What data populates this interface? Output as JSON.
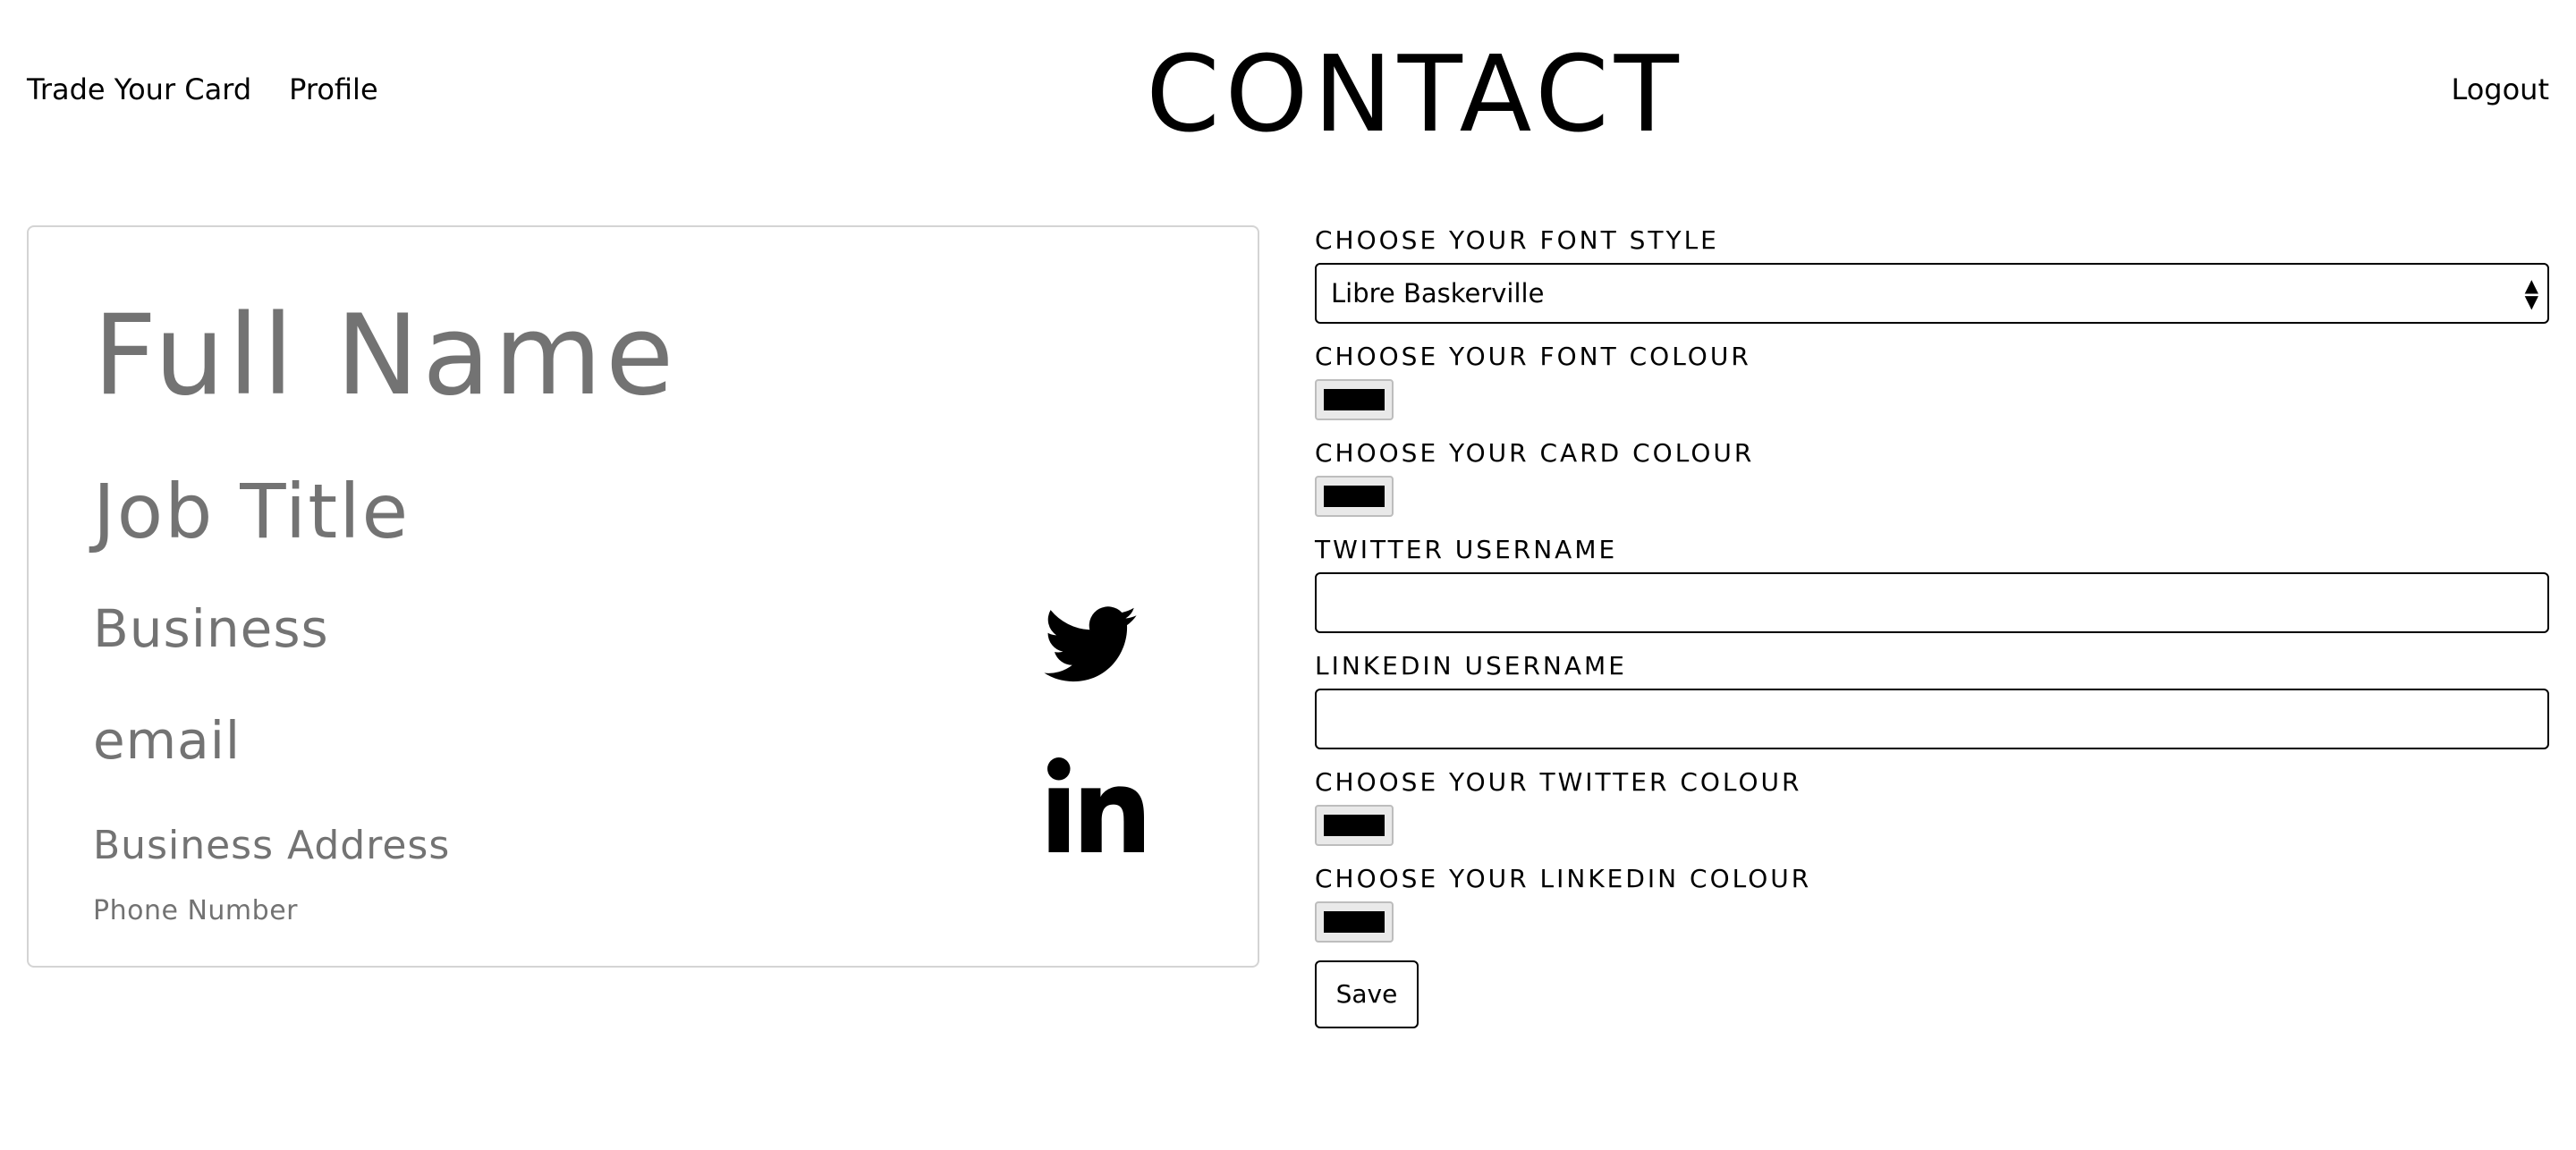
{
  "nav": {
    "trade_label": "Trade Your Card",
    "profile_label": "Profile",
    "logout_label": "Logout"
  },
  "page": {
    "title": "CONTACT"
  },
  "card": {
    "full_name": "Full Name",
    "job_title": "Job Title",
    "business": "Business",
    "email": "email",
    "address": "Business Address",
    "phone": "Phone Number",
    "text_color": "#737373",
    "icons": [
      "twitter-icon",
      "linkedin-icon"
    ]
  },
  "form": {
    "font_style_label": "CHOOSE YOUR FONT STYLE",
    "font_style_value": "Libre Baskerville",
    "font_colour_label": "CHOOSE YOUR FONT COLOUR",
    "font_colour_value": "#000000",
    "card_colour_label": "CHOOSE YOUR CARD COLOUR",
    "card_colour_value": "#000000",
    "twitter_label": "TWITTER USERNAME",
    "twitter_value": "",
    "linkedin_label": "LINKEDIN USERNAME",
    "linkedin_value": "",
    "twitter_colour_label": "CHOOSE YOUR TWITTER COLOUR",
    "twitter_colour_value": "#000000",
    "linkedin_colour_label": "CHOOSE YOUR LINKEDIN COLOUR",
    "linkedin_colour_value": "#000000",
    "save_label": "Save"
  }
}
